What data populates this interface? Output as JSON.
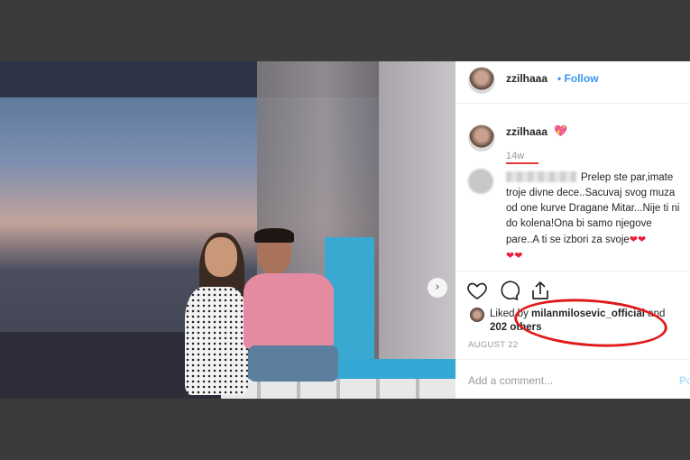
{
  "post": {
    "username": "zzilhaaa",
    "follow_label": "Follow",
    "separator": "•",
    "caption_emoji": "💖",
    "time_ago": "14w",
    "comment": {
      "lines": "Prelep ste par,imate troje divne dece..Sacuvaj svog muza od one kurve Dragane Mitar...Nije ti ni do kolena!Ona bi samo njegove pare..A ti se izbori za svoje",
      "hearts_inline": "❤❤",
      "hearts_end": "❤❤"
    },
    "likes": {
      "prefix": "Liked by",
      "liker": "milanmilosevic_official",
      "conjunction": "and",
      "others": "202 others"
    },
    "date": "AUGUST 22",
    "add_comment_placeholder": "Add a comment...",
    "post_button": "Post",
    "carousel_next": "›"
  },
  "icons": {
    "like": "heart-outline-icon",
    "comment": "comment-bubble-icon",
    "share": "share-icon",
    "next": "chevron-right-icon"
  },
  "colors": {
    "link_blue": "#3897f0",
    "annotation_red": "#e01b1b",
    "heart_red": "#ed1c3c"
  }
}
